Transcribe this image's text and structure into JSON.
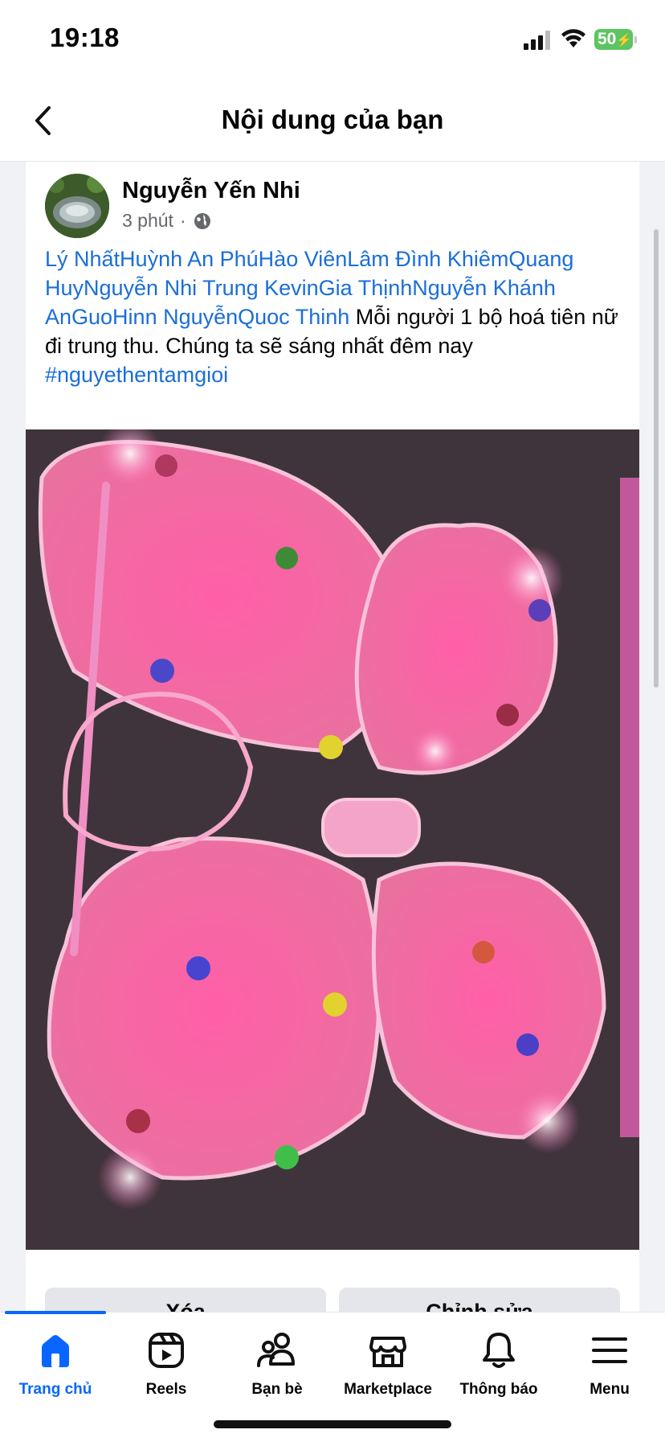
{
  "status_bar": {
    "time": "19:18",
    "battery": "50"
  },
  "header": {
    "title": "Nội dung của bạn",
    "back_icon": "chevron-left-icon"
  },
  "post": {
    "author": "Nguyễn Yến Nhi",
    "time": "3 phút",
    "separator": "·",
    "audience_icon": "globe-icon",
    "tags": "Lý NhấtHuỳnh An PhúHào ViênLâm Đình KhiêmQuang HuyNguyễn Nhi Trung KevinGia ThịnhNguyễn Khánh AnGuoHinn NguyễnQuoc Thinh",
    "message": " Mỗi người 1 bộ hoá tiên nữ đi trung thu. Chúng ta sẽ sáng nhất đêm nay",
    "hashtag": "#nguyethentamgioi",
    "photo_icon": "photo",
    "actions": {
      "delete": "Xóa",
      "edit": "Chỉnh sửa"
    }
  },
  "tab_bar": {
    "accent": "#0866ff",
    "items": [
      {
        "label": "Trang chủ",
        "icon": "home-icon",
        "active": true
      },
      {
        "label": "Reels",
        "icon": "reels-icon"
      },
      {
        "label": "Bạn bè",
        "icon": "friends-icon"
      },
      {
        "label": "Marketplace",
        "icon": "marketplace-icon"
      },
      {
        "label": "Thông báo",
        "icon": "bell-icon"
      },
      {
        "label": "Menu",
        "icon": "menu-icon"
      }
    ]
  }
}
